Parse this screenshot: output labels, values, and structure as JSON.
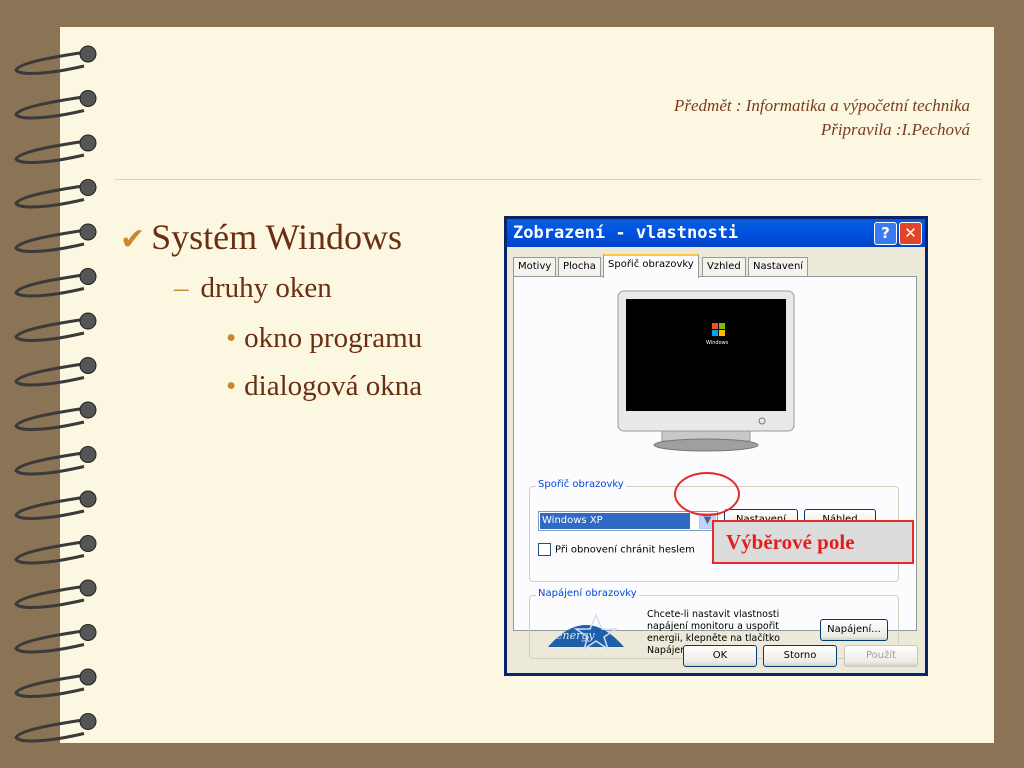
{
  "header": {
    "line1": "Předmět : Informatika a výpočetní technika",
    "line2": "Připravila :I.Pechová"
  },
  "outline": {
    "level1": "Systém Windows",
    "level2": "druhy oken",
    "level3": [
      "okno programu",
      "dialogová okna"
    ]
  },
  "dialog": {
    "title": "Zobrazení - vlastnosti",
    "help_label": "?",
    "close_label": "✕",
    "tabs": [
      "Motivy",
      "Plocha",
      "Spořič obrazovky",
      "Vzhled",
      "Nastavení"
    ],
    "active_tab": "Spořič obrazovky",
    "monitor_logo": "Windows",
    "screensaver_group": "Spořič obrazovky",
    "screensaver_value": "Windows XP",
    "settings_button": "Nastavení",
    "preview_button": "Náhled",
    "password_checkbox": "Při obnovení chránit heslem",
    "power_group": "Napájení obrazovky",
    "power_text": "Chcete-li nastavit vlastnosti napájení monitoru a uspořit energii, klepněte na tlačítko Napájení.",
    "energy_logo": "energy",
    "power_button": "Napájení...",
    "ok_button": "OK",
    "cancel_button": "Storno",
    "apply_button": "Použít"
  },
  "callout": {
    "label": "Výběrové pole"
  },
  "colors": {
    "title_bar": "#0054e3",
    "callout_red": "#e32b2b",
    "paper": "#fbf7e0"
  }
}
